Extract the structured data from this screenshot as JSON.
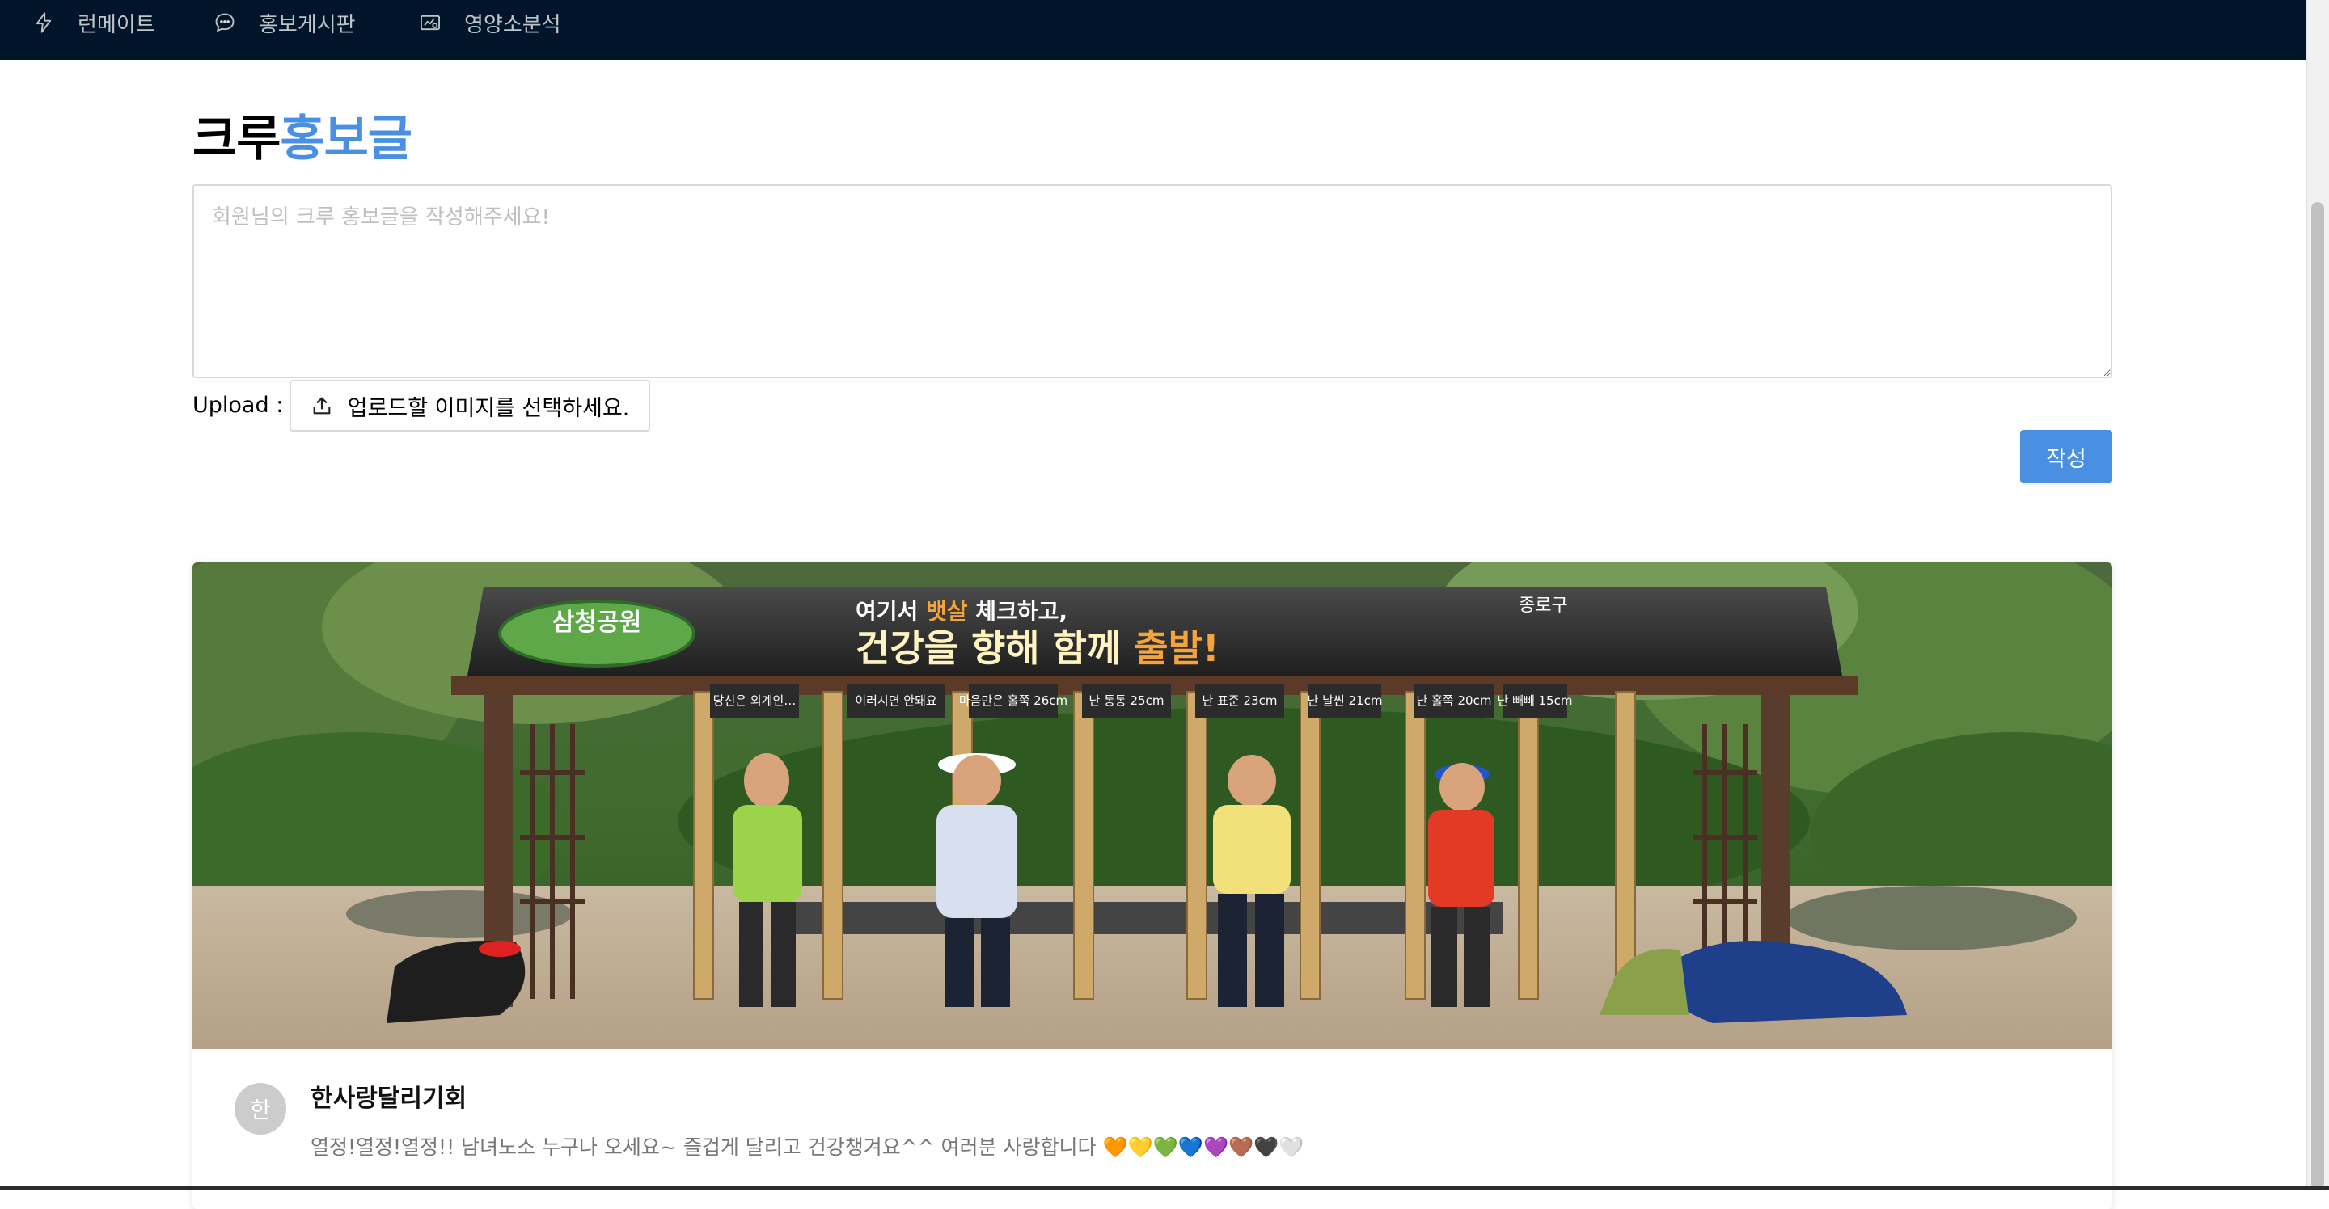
{
  "nav": {
    "items": [
      {
        "label": "런메이트",
        "icon": "lightning-icon"
      },
      {
        "label": "홍보게시판",
        "icon": "chat-bubble-icon"
      },
      {
        "label": "영양소분석",
        "icon": "nutrition-chart-icon"
      }
    ]
  },
  "page": {
    "title_plain": "크루",
    "title_accent": "홍보글",
    "accent_color": "#4a90e2"
  },
  "form": {
    "placeholder": "회원님의 크루 홍보글을 작성해주세요!",
    "upload_label": "Upload :",
    "upload_button": "업로드할 이미지를 선택하세요.",
    "submit_button": "작성"
  },
  "post": {
    "avatar_initial": "한",
    "author": "한사랑달리기회",
    "content": "열정!열정!열정!! 남녀노소 누구나 오세요~ 즐겁게 달리고 건강챙겨요^^ 여러분 사랑합니다 🧡💛💚💙💜🤎🖤🤍",
    "photo": {
      "sign_top_left": "삼청공원",
      "sign_top_middle_pre": "여기서 ",
      "sign_top_middle_accent": "뱃살",
      "sign_top_middle_post": " 체크하고,",
      "sign_top_right": "종로구",
      "sign_main": "건강을 향해 함께 ",
      "sign_main_accent": "출발!",
      "labels": [
        "당신은 외계인…",
        "이러시면 안돼요",
        "마음만은 홀쭉 26cm",
        "난 통통 25cm",
        "난 표준 23cm",
        "난 날씬 21cm",
        "난 홀쭉 20cm",
        "난 빼빼 15cm"
      ]
    }
  }
}
